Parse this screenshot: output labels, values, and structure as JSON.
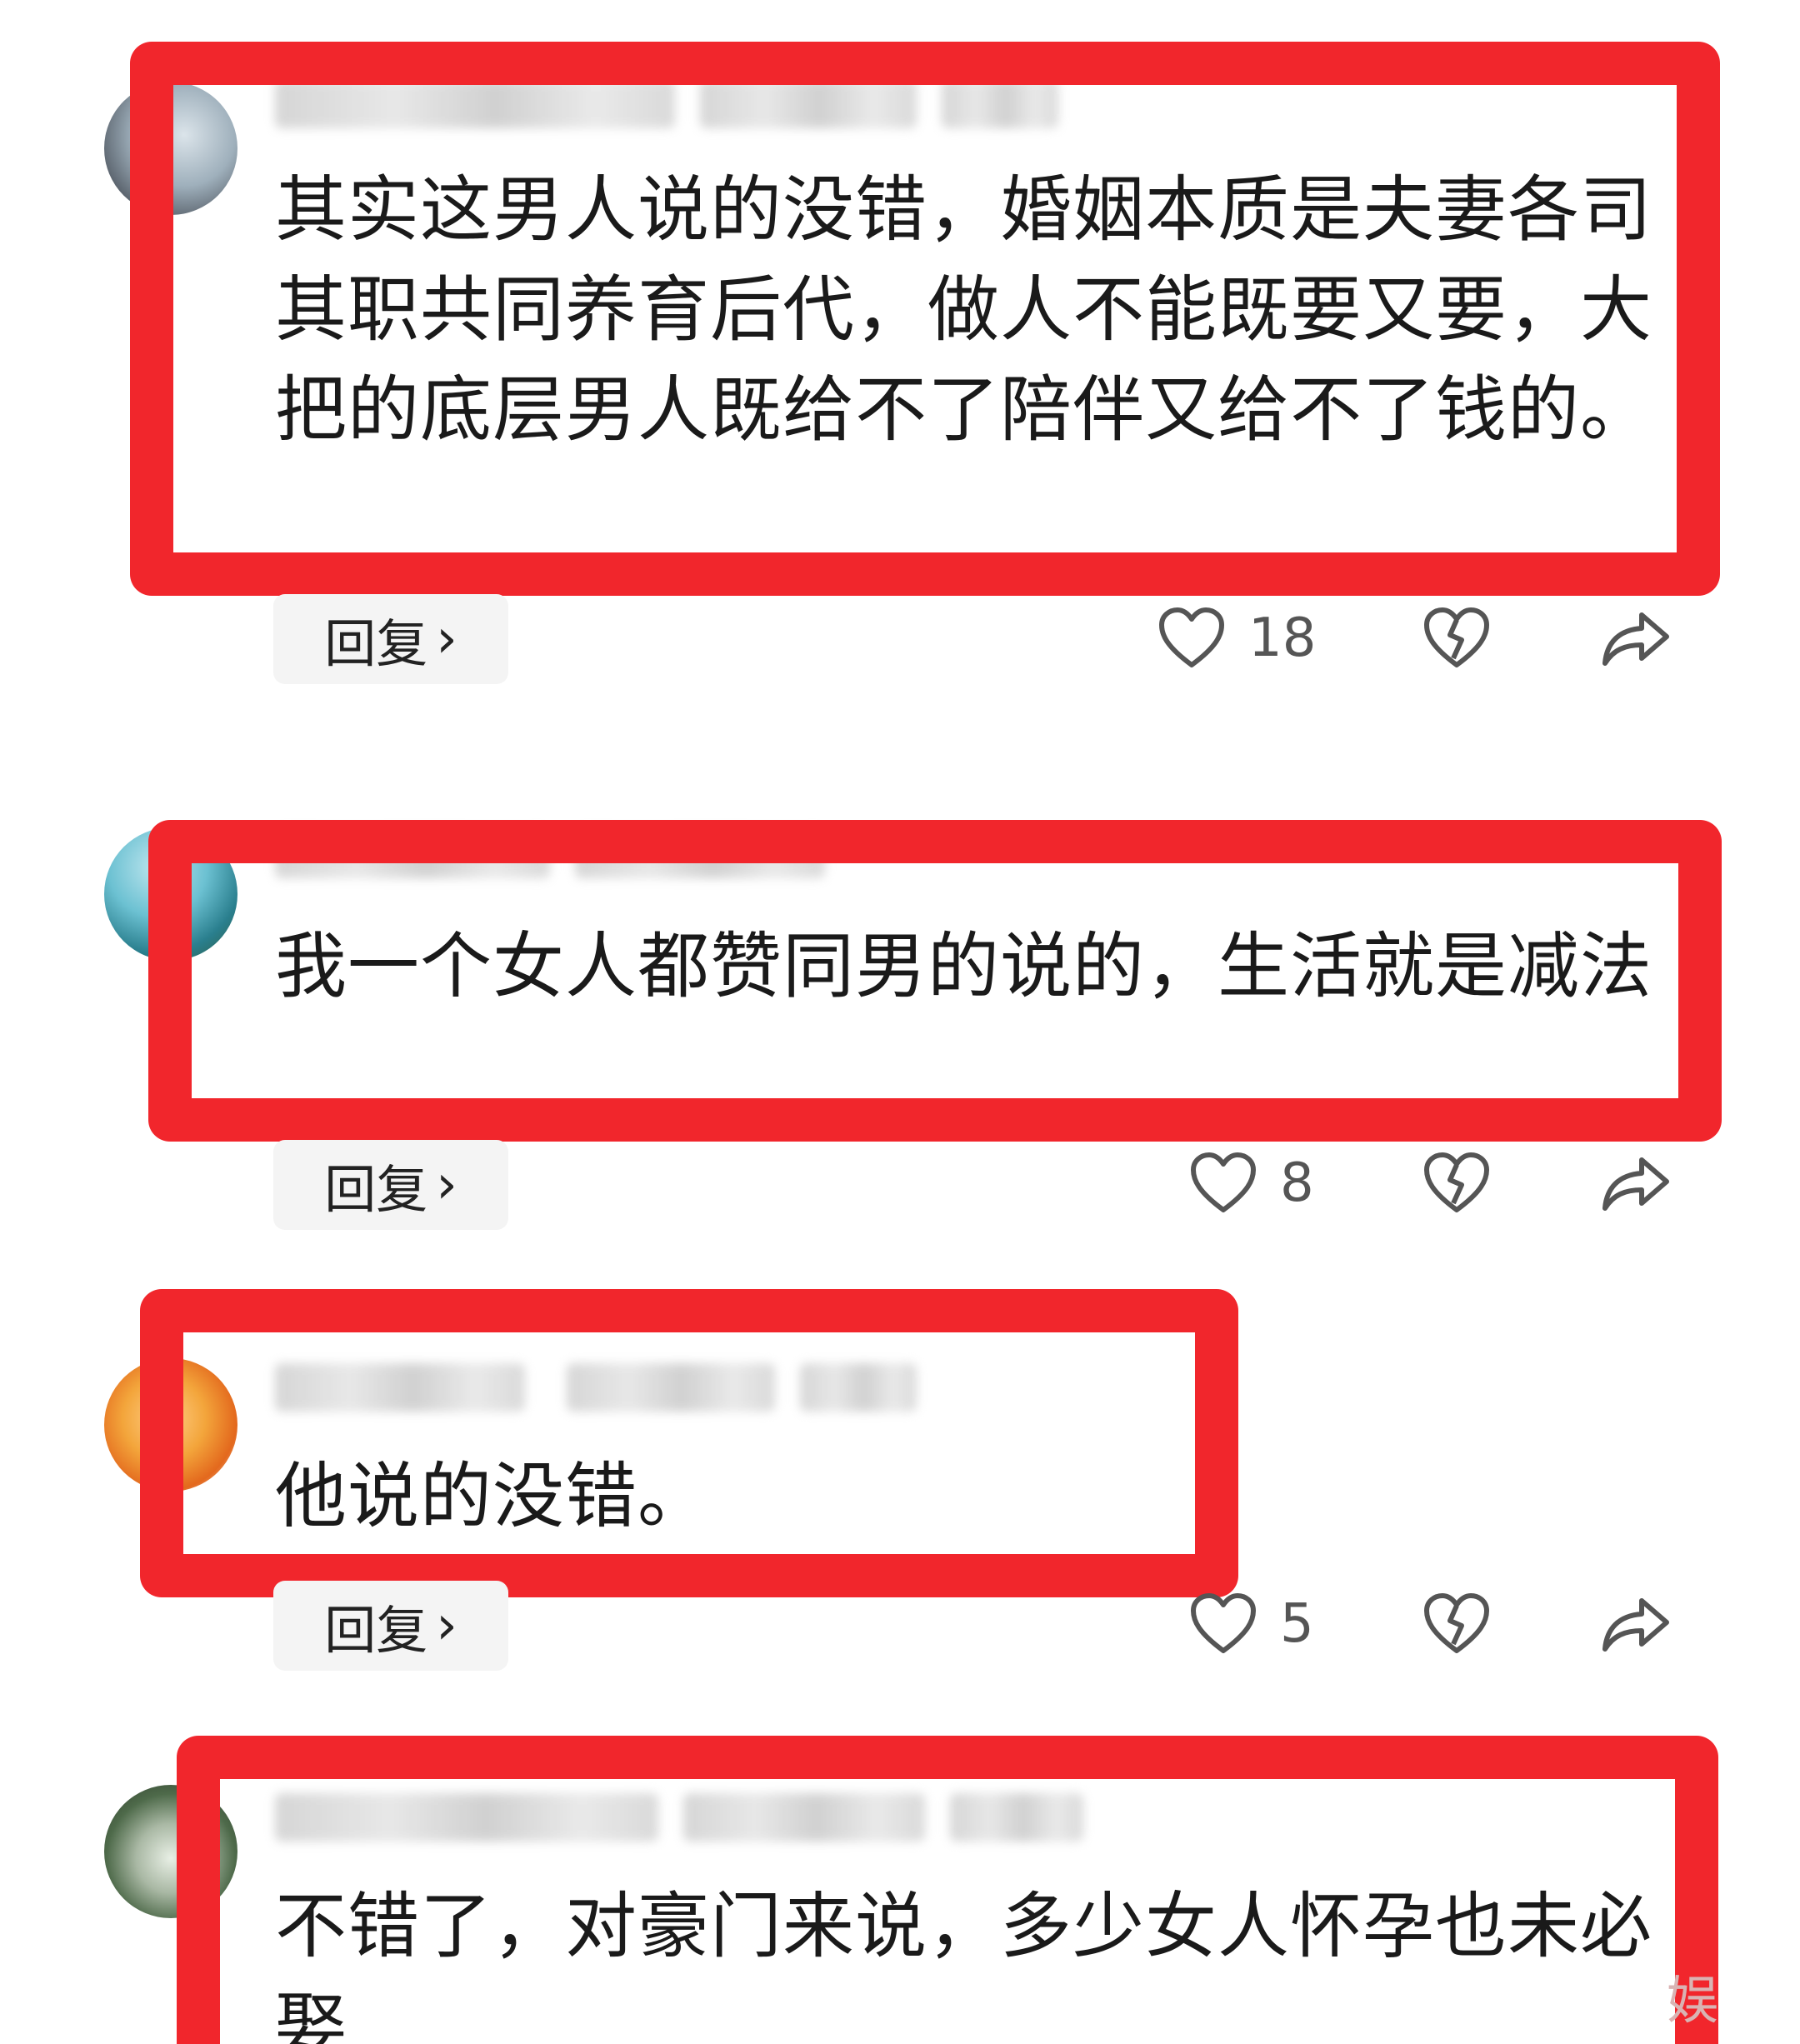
{
  "comments": [
    {
      "text": "其实这男人说的没错，婚姻本质是夫妻各司其职共同养育后代，做人不能既要又要，大把的底层男人既给不了陪伴又给不了钱的。",
      "reply_label": "回复",
      "likes": "18"
    },
    {
      "text": "我一个女人都赞同男的说的，生活就是减法",
      "reply_label": "回复",
      "likes": "8"
    },
    {
      "text": "他说的没错。",
      "reply_label": "回复",
      "likes": "5"
    },
    {
      "text": "不错了，对豪门来说，多少女人怀孕也未必娶"
    }
  ],
  "watermark": "娱",
  "colors": {
    "highlight": "#f1262c",
    "text": "#1a1a1a",
    "icon": "#555555"
  },
  "icons": [
    "heart-outline-icon",
    "broken-heart-icon",
    "share-icon",
    "chevron-right-icon"
  ]
}
